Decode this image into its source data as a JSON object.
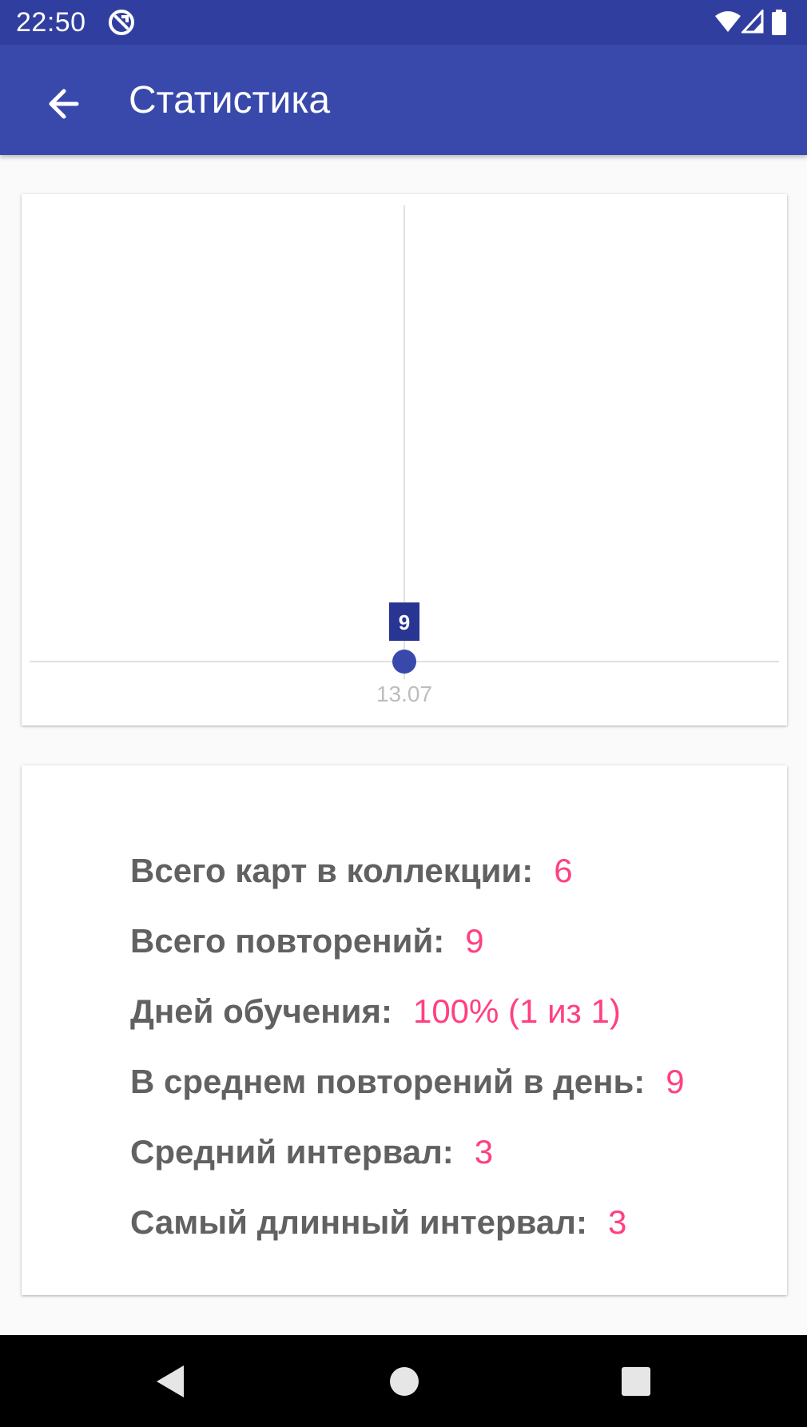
{
  "status_bar": {
    "time": "22:50",
    "icons": [
      "app-notification-icon",
      "wifi-icon",
      "signal-icon",
      "battery-icon"
    ]
  },
  "app_bar": {
    "title": "Статистика",
    "back_icon": "arrow-back-icon"
  },
  "chart_data": {
    "type": "line",
    "x": [
      "13.07"
    ],
    "series": [
      {
        "values": [
          9
        ]
      }
    ],
    "data_labels": [
      "9"
    ],
    "grid": true,
    "colors": {
      "point": "#3949ab",
      "label_bg": "#283593",
      "axis": "#e0e0e0",
      "tick_label": "#bdbdbd"
    }
  },
  "stats": [
    {
      "label": "Всего карт в коллекции:",
      "value": "6"
    },
    {
      "label": "Всего повторений:",
      "value": "9"
    },
    {
      "label": "Дней обучения:",
      "value": "100% (1 из 1)"
    },
    {
      "label": "В среднем повторений в день:",
      "value": "9"
    },
    {
      "label": "Средний интервал:",
      "value": "3"
    },
    {
      "label": "Самый длинный интервал:",
      "value": "3"
    }
  ],
  "nav_bar": {
    "buttons": [
      "back-triangle-icon",
      "home-circle-icon",
      "recents-square-icon"
    ]
  },
  "colors": {
    "primary_dark": "#303f9f",
    "primary": "#3949ab",
    "accent": "#ff4081",
    "label_text": "#616161"
  }
}
